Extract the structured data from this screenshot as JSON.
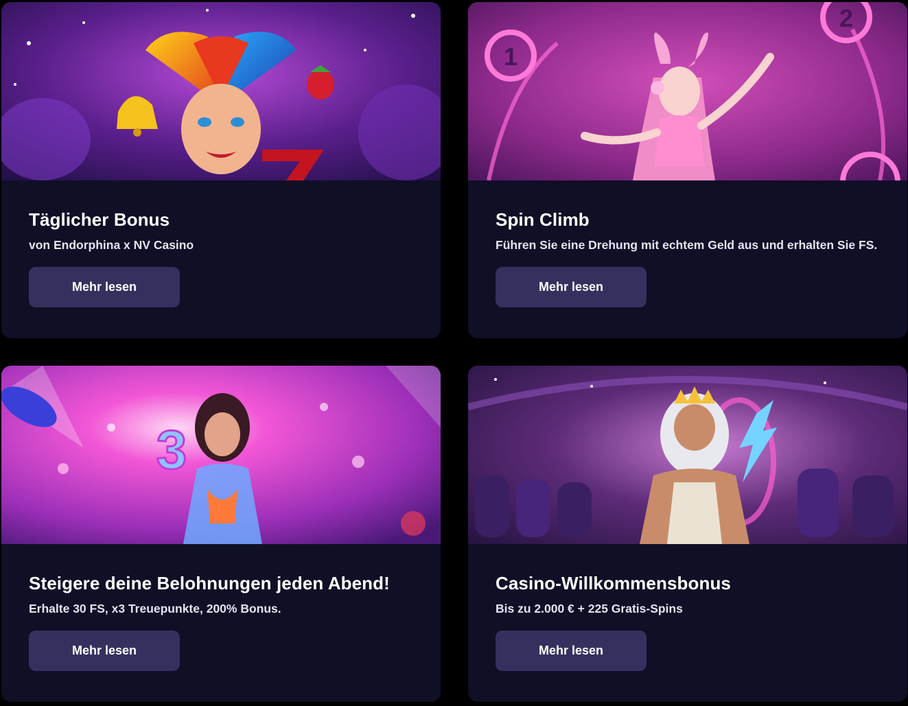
{
  "promotions": [
    {
      "title": "Täglicher Bonus",
      "subtitle": "von Endorphina x NV Casino",
      "button_label": "Mehr lesen",
      "image": "jester-slot-artwork"
    },
    {
      "title": "Spin Climb",
      "subtitle": "Führen Sie eine Drehung mit echtem Geld aus und erhalten Sie FS.",
      "button_label": "Mehr lesen",
      "image": "pink-bunny-girl-artwork",
      "image_text": [
        "1",
        "2"
      ]
    },
    {
      "title": "Steigere deine Belohnungen jeden Abend!",
      "subtitle": "Erhalte 30 FS, x3 Treuepunkte, 200% Bonus.",
      "button_label": "Mehr lesen",
      "image": "neon-party-girl-artwork",
      "image_text": [
        "3"
      ]
    },
    {
      "title": "Casino-Willkommensbonus",
      "subtitle": "Bis zu 2.000 € + 225 Gratis-Spins",
      "button_label": "Mehr lesen",
      "image": "zeus-casino-artwork"
    }
  ],
  "colors": {
    "page_background": "#000000",
    "card_background": "#0f0f26",
    "button_background": "#34315f",
    "text": "#ffffff"
  }
}
